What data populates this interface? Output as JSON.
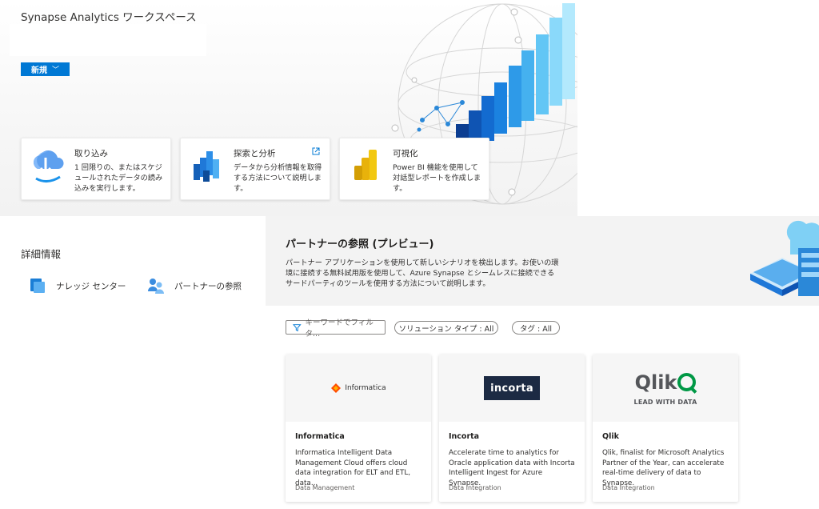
{
  "hero": {
    "title": "Synapse Analytics ワークスペース",
    "new_button": "新規"
  },
  "cards": [
    {
      "title": "取り込み",
      "description": "1 回限りの、またはスケジュールされたデータの読み込みを実行します。",
      "icon": "cloud-ingest-icon"
    },
    {
      "title": "探索と分析",
      "description": "データから分析情報を取得する方法について説明します。",
      "icon": "data-bars-icon",
      "external": true
    },
    {
      "title": "可視化",
      "description": "Power BI 機能を使用して対話型レポートを作成します。",
      "icon": "power-bi-icon"
    }
  ],
  "info": {
    "title": "詳細情報",
    "items": [
      {
        "label": "ナレッジ センター",
        "icon": "knowledge-center-icon"
      },
      {
        "label": "パートナーの参照",
        "icon": "partners-icon"
      }
    ]
  },
  "partners": {
    "title": "パートナーの参照 (プレビュー)",
    "description": "パートナー アプリケーションを使用して新しいシナリオを検出します。お使いの環境に接続する無料試用版を使用して、Azure Synapse とシームレスに接続できるサードパーティのツールを使用する方法について説明します。",
    "filter_placeholder": "キーワードでフィルタ...",
    "solution_type_filter": "ソリューション タイプ : All",
    "tag_filter": "タグ : All",
    "items": [
      {
        "name": "Informatica",
        "logo_text": "Informatica",
        "description": "Informatica Intelligent Data Management Cloud offers cloud data integration for ELT and ETL, data...",
        "category": "Data Management"
      },
      {
        "name": "Incorta",
        "logo_text": "incorta",
        "description": "Accelerate time to analytics for Oracle application data with Incorta Intelligent Ingest for Azure Synapse.",
        "category": "Data Integration"
      },
      {
        "name": "Qlik",
        "logo_text": "Qlik",
        "logo_tagline": "LEAD WITH DATA",
        "description": "Qlik, finalist for Microsoft Analytics Partner of the Year, can accelerate real-time delivery of data to Synapse.",
        "category": "Data Integration"
      }
    ]
  },
  "colors": {
    "accent": "#0078d4",
    "incorta_bg": "#1c2a43",
    "qlik_green": "#009845",
    "informatica_orange": "#ff4d00"
  }
}
